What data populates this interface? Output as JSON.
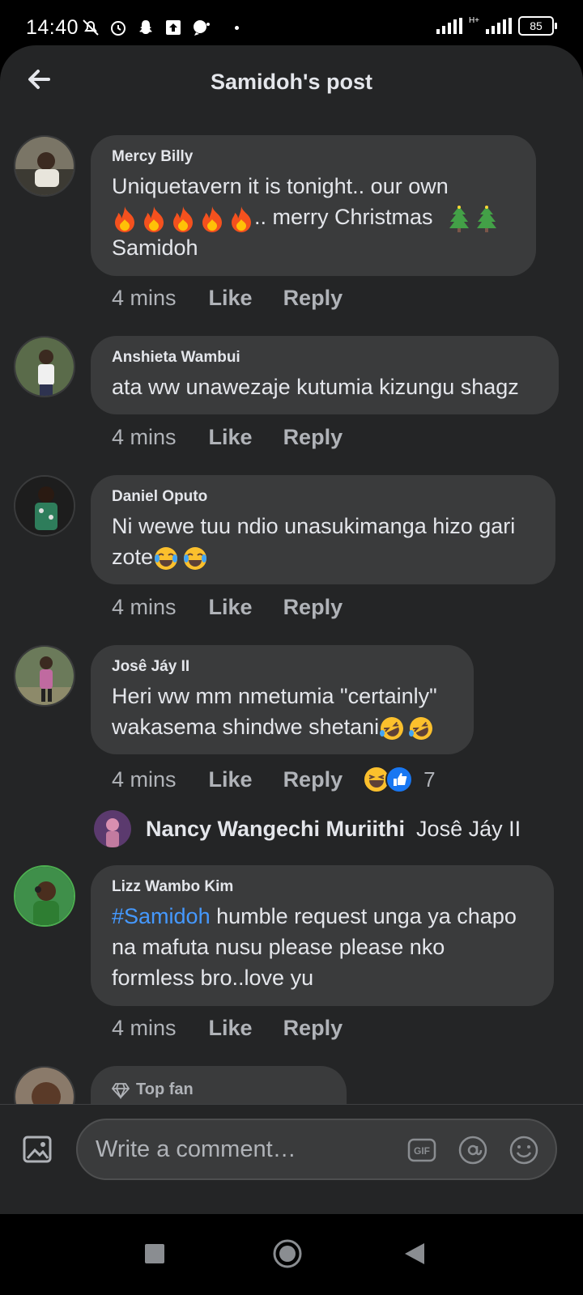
{
  "status": {
    "time": "14:40",
    "network": "H+",
    "battery": "85"
  },
  "header": {
    "title": "Samidoh's post"
  },
  "comments": [
    {
      "author": "Mercy Billy",
      "text_line1": "Uniquetavern it is tonight.. our own",
      "text_line2_suffix": ".. merry Christmas",
      "text_line3": "Samidoh",
      "time": "4 mins",
      "like": "Like",
      "reply": "Reply"
    },
    {
      "author": "Anshieta Wambui",
      "text": "ata ww unawezaje kutumia kizungu shagz",
      "time": "4 mins",
      "like": "Like",
      "reply": "Reply"
    },
    {
      "author": "Daniel Oputo",
      "text_line1": "Ni wewe tuu ndio unasukimanga hizo gari",
      "text_line2": "zote",
      "time": "4 mins",
      "like": "Like",
      "reply": "Reply"
    },
    {
      "author": "Josê Jáy II",
      "text_line1": "Heri ww mm nmetumia \"certainly\"",
      "text_line2": "wakasema shindwe shetani",
      "time": "4 mins",
      "like": "Like",
      "reply": "Reply",
      "reaction_count": "7"
    },
    {
      "author": "Lizz Wambo Kim",
      "hashtag": "#Samidoh",
      "text_line1": " humble request unga ya chapo",
      "text_line2": "na mafuta nusu please please nko",
      "text_line3": "formless bro..love yu",
      "time": "4 mins",
      "like": "Like",
      "reply": "Reply"
    }
  ],
  "reply_preview": {
    "name": "Nancy Wangechi Muriithi",
    "reply_to": "Josê Jáy II"
  },
  "partial_comment": {
    "badge": "Top fan"
  },
  "composer": {
    "placeholder": "Write a comment…",
    "gif_label": "GIF"
  }
}
